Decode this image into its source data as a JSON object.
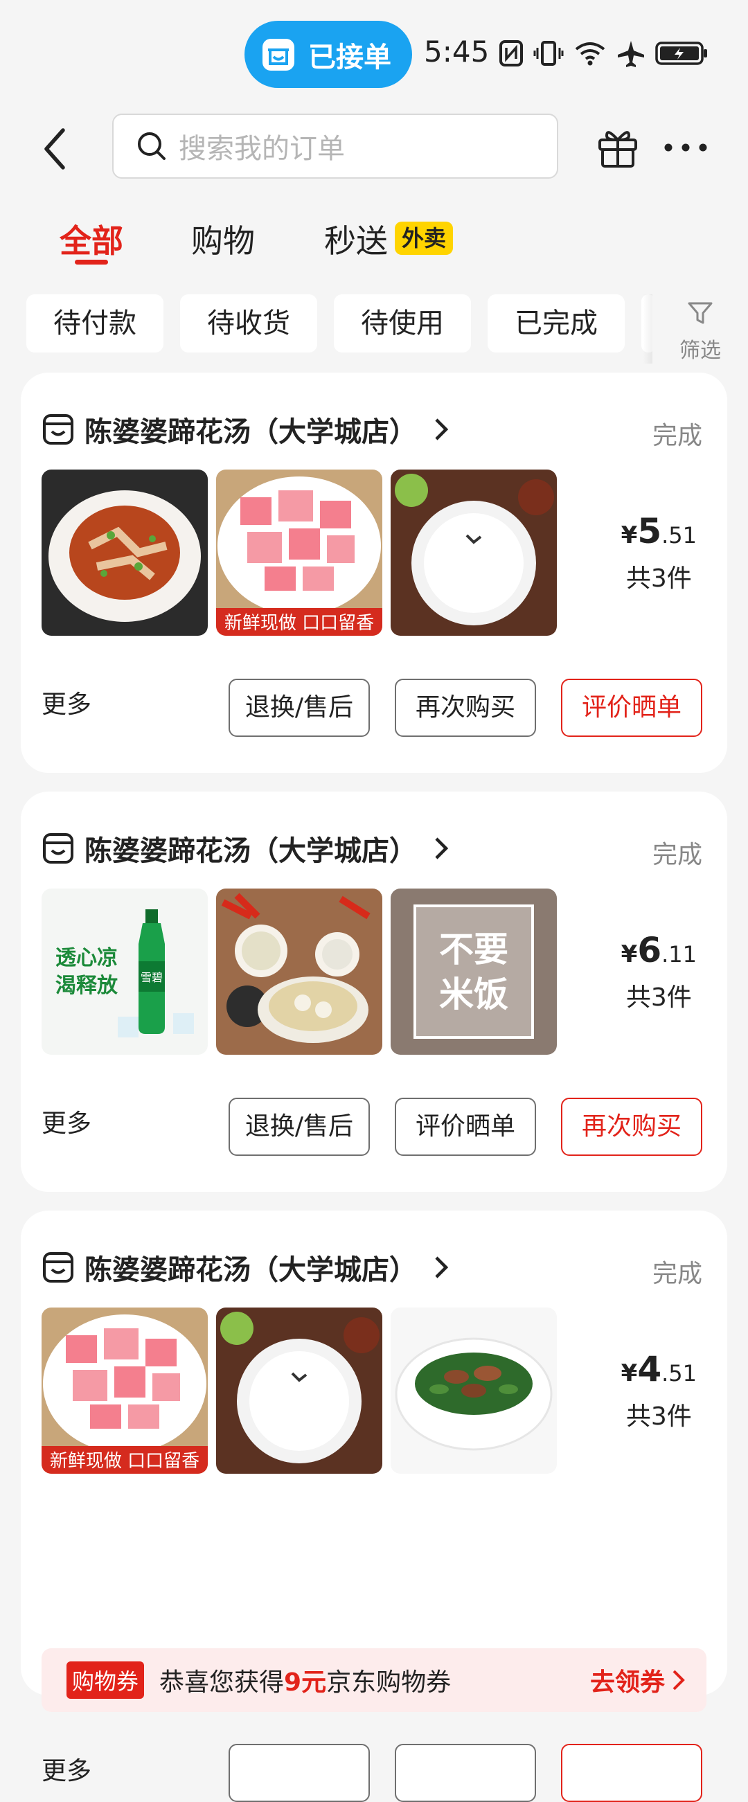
{
  "status_bar": {
    "pill_text": "已接单",
    "time": "5:45"
  },
  "search": {
    "placeholder": "搜索我的订单"
  },
  "tabs": [
    {
      "label": "全部",
      "active": true
    },
    {
      "label": "购物",
      "active": false
    },
    {
      "label": "秒送",
      "active": false
    }
  ],
  "takeout_badge": "外卖",
  "filters": {
    "chips": [
      "待付款",
      "待收货",
      "待使用",
      "已完成"
    ],
    "filter_label": "筛选"
  },
  "orders": [
    {
      "store": "陈婆婆蹄花汤（大学城店）",
      "status": "完成",
      "items": [
        "spicy-pork-dish",
        "pickled-radish",
        "rice-bowl"
      ],
      "price_symbol": "¥",
      "price_int": "5",
      "price_dec": ".51",
      "count": "共3件",
      "more": "更多",
      "buttons": [
        "退换/售后",
        "再次购买",
        "评价晒单"
      ]
    },
    {
      "store": "陈婆婆蹄花汤（大学城店）",
      "status": "完成",
      "items": [
        "sprite-bottle",
        "soup-set",
        "no-rice"
      ],
      "price_symbol": "¥",
      "price_int": "6",
      "price_dec": ".11",
      "count": "共3件",
      "more": "更多",
      "buttons": [
        "退换/售后",
        "评价晒单",
        "再次购买"
      ]
    },
    {
      "store": "陈婆婆蹄花汤（大学城店）",
      "status": "完成",
      "items": [
        "pickled-radish",
        "rice-bowl",
        "stir-fry-greens"
      ],
      "price_symbol": "¥",
      "price_int": "4",
      "price_dec": ".51",
      "count": "共3件",
      "coupon": {
        "tag": "购物券",
        "text_prefix": "恭喜您获得",
        "amount": "9元",
        "text_suffix": "京东购物券",
        "action": "去领券"
      },
      "more": "更多"
    }
  ],
  "thumb_text": {
    "fresh_made": "新鲜现做 口口留香",
    "sprite_slogan_1": "透心凉",
    "sprite_slogan_2": "渴释放",
    "sprite_brand": "雪碧",
    "no_rice_1": "不要",
    "no_rice_2": "米饭"
  },
  "colors": {
    "accent": "#e2231a",
    "pill": "#1aa3f1",
    "badge": "#ffd400"
  }
}
